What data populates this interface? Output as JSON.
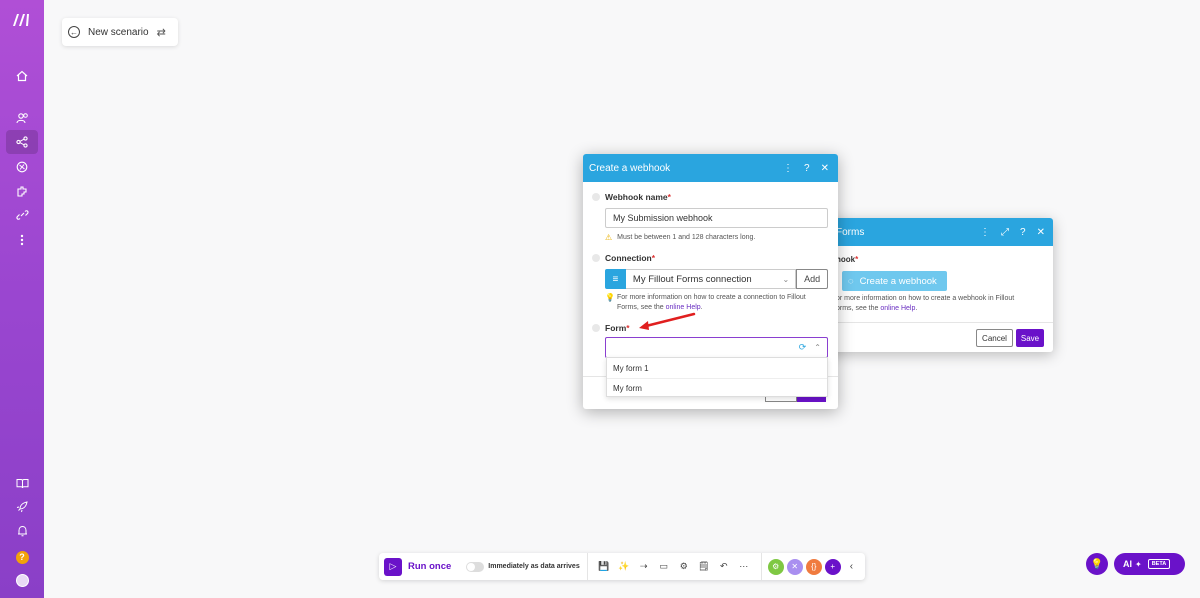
{
  "scenario": {
    "title": "New scenario"
  },
  "sidebar": {
    "items": [
      {
        "name": "home-icon",
        "glyph": "⌂"
      },
      {
        "name": "team-icon",
        "glyph": "👥"
      },
      {
        "name": "scenarios-icon",
        "glyph": "⤨"
      },
      {
        "name": "templates-icon",
        "glyph": "⊛"
      },
      {
        "name": "apps-icon",
        "glyph": "⧉"
      },
      {
        "name": "connections-icon",
        "glyph": "∞"
      },
      {
        "name": "more-icon",
        "glyph": "⋮"
      }
    ],
    "bottom": [
      {
        "name": "docs-icon",
        "glyph": "📖"
      },
      {
        "name": "rocket-icon",
        "glyph": "🚀"
      },
      {
        "name": "bell-icon",
        "glyph": "🔔"
      },
      {
        "name": "help-icon",
        "glyph": "?"
      },
      {
        "name": "avatar",
        "glyph": "●"
      }
    ]
  },
  "back_panel": {
    "title": "Forms",
    "field_label": "hook",
    "button_label": "Create a webhook",
    "help_text": "or more information on how to create a webhook in Fillout",
    "help_text2": "orms, see the ",
    "help_link": "online Help",
    "help_end": ".",
    "cancel": "Cancel",
    "save": "Save"
  },
  "front_panel": {
    "title": "Create a webhook",
    "webhook_name_label": "Webhook name",
    "webhook_name_value": "My Submission webhook",
    "webhook_name_warning": "Must be between 1 and 128 characters long.",
    "connection_label": "Connection",
    "connection_value": "My Fillout Forms connection",
    "add_label": "Add",
    "connection_help": "For more information on how to create a connection to Fillout",
    "connection_help2": "Forms, see the ",
    "connection_help_link": "online Help",
    "connection_help_end": ".",
    "form_label": "Form",
    "required": "*",
    "form_options": [
      "My form 1",
      "My form"
    ]
  },
  "toolbar": {
    "run_label": "Run once",
    "schedule_label": "Immediately as data arrives"
  },
  "ai": {
    "label": "AI",
    "beta": "BETA"
  },
  "colors": {
    "accent": "#6a12c9",
    "header": "#2aa5df",
    "sidebar": "#9a46d0"
  }
}
